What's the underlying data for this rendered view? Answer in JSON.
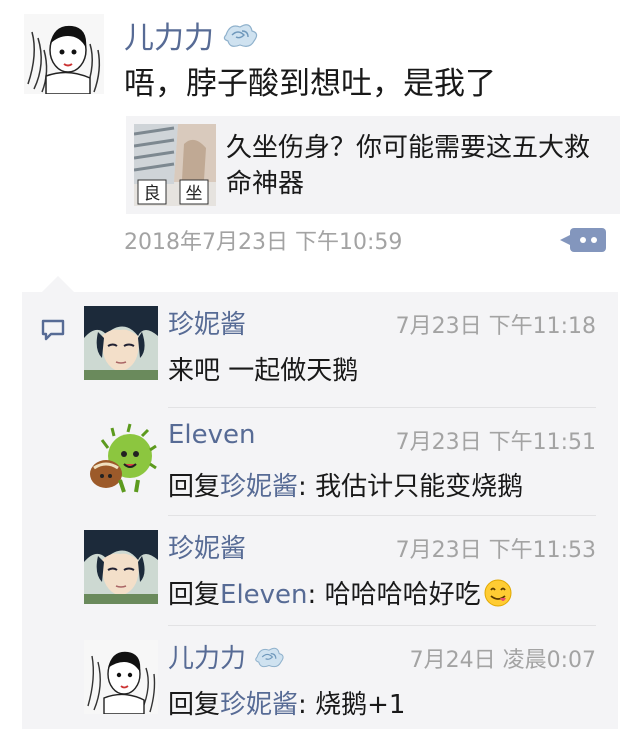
{
  "post": {
    "author": "儿力力",
    "text": "唔，脖子酸到想吐，是我了",
    "share": {
      "thumb_chars": [
        "良",
        "坐"
      ],
      "title": "久坐伤身？你可能需要这五大救命神器"
    },
    "time": "2018年7月23日 下午10:59"
  },
  "comments": [
    {
      "author": "珍妮酱",
      "time": "7月23日 下午11:18",
      "reply_prefix": "",
      "reply_to": "",
      "reply_sep": "",
      "text": "来吧 一起做天鹅"
    },
    {
      "author": "Eleven",
      "time": "7月23日 下午11:51",
      "reply_prefix": "回复",
      "reply_to": "珍妮酱",
      "reply_sep": ": ",
      "text": "我估计只能变烧鹅"
    },
    {
      "author": "珍妮酱",
      "time": "7月23日 下午11:53",
      "reply_prefix": "回复",
      "reply_to": "Eleven",
      "reply_sep": ": ",
      "text": "哈哈哈哈好吃"
    },
    {
      "author": "儿力力",
      "time": "7月24日 凌晨0:07",
      "reply_prefix": "回复",
      "reply_to": "珍妮酱",
      "reply_sep": ": ",
      "text": "烧鹅+1"
    }
  ],
  "colors": {
    "link": "#576b95",
    "text": "#191919",
    "meta": "#a3a3a3",
    "comment_bg": "#f4f4f6"
  },
  "icons": {
    "name_decoration": "swirl-emoji-icon",
    "comment_marker": "comment-bubble-icon",
    "more_button": "more-dots-icon",
    "emoji_in_comment": "yum-face-emoji-icon"
  }
}
